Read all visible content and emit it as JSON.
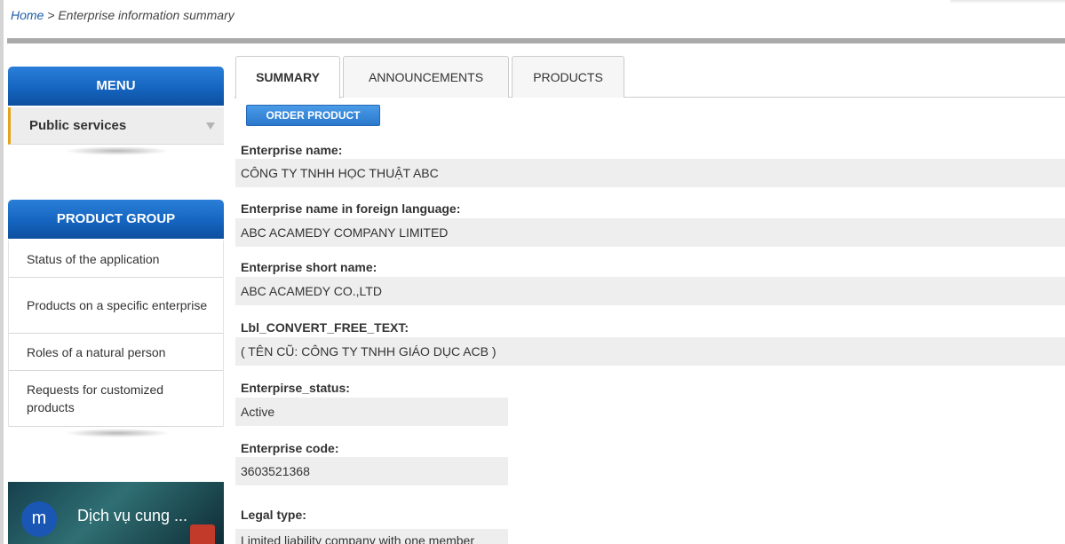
{
  "breadcrumb": {
    "home": "Home",
    "separator": ">",
    "current": "Enterprise information summary"
  },
  "sidebar": {
    "menu_title": "MENU",
    "menu_item": "Public services",
    "product_group_title": "PRODUCT GROUP",
    "product_group_items": [
      "Status of the application",
      "Products on a specific enterprise",
      "Roles of a natural person",
      "Requests for customized products"
    ],
    "video": {
      "avatar_letter": "m",
      "title": "Dịch vụ cung ..."
    }
  },
  "tabs": [
    {
      "label": "SUMMARY",
      "active": true
    },
    {
      "label": "ANNOUNCEMENTS",
      "active": false
    },
    {
      "label": "PRODUCTS",
      "active": false
    }
  ],
  "order_button": "ORDER PRODUCT",
  "fields": [
    {
      "label": "Enterprise name:",
      "value": "CÔNG TY TNHH HỌC THUẬT ABC"
    },
    {
      "label": "Enterprise name in foreign language:",
      "value": "ABC ACAMEDY COMPANY LIMITED"
    },
    {
      "label": "Enterprise short name:",
      "value": "ABC ACAMEDY CO.,LTD"
    },
    {
      "label": "Lbl_CONVERT_FREE_TEXT:",
      "value": "( TÊN CŨ: CÔNG TY TNHH GIÁO DỤC ACB )"
    },
    {
      "label": "Enterpirse_status:",
      "value": "Active"
    },
    {
      "label": "Enterprise code:",
      "value": "3603521368"
    },
    {
      "label": "Legal type:",
      "value": "Limited liability company with one member"
    }
  ],
  "colors": {
    "header_blue": "#1565c0",
    "menu_accent": "#e3a41c",
    "link": "#1f5ea8",
    "button_blue": "#2a78cc"
  }
}
